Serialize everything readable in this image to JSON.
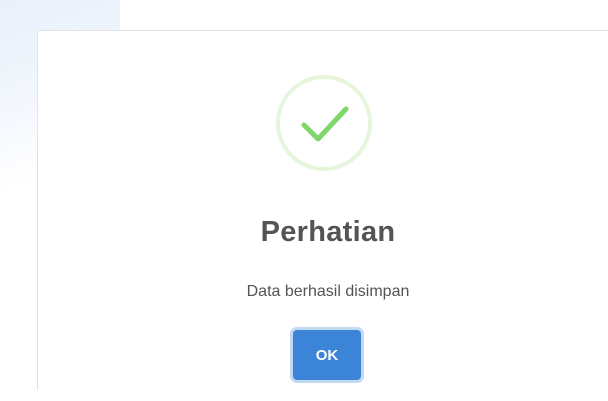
{
  "dialog": {
    "icon": "checkmark-success-icon",
    "title": "Perhatian",
    "message": "Data berhasil disimpan",
    "confirm_label": "OK"
  },
  "colors": {
    "success_green": "#7fd76a",
    "success_ring": "#e6f6dc",
    "button_blue": "#3b84d8",
    "text": "#545454"
  }
}
